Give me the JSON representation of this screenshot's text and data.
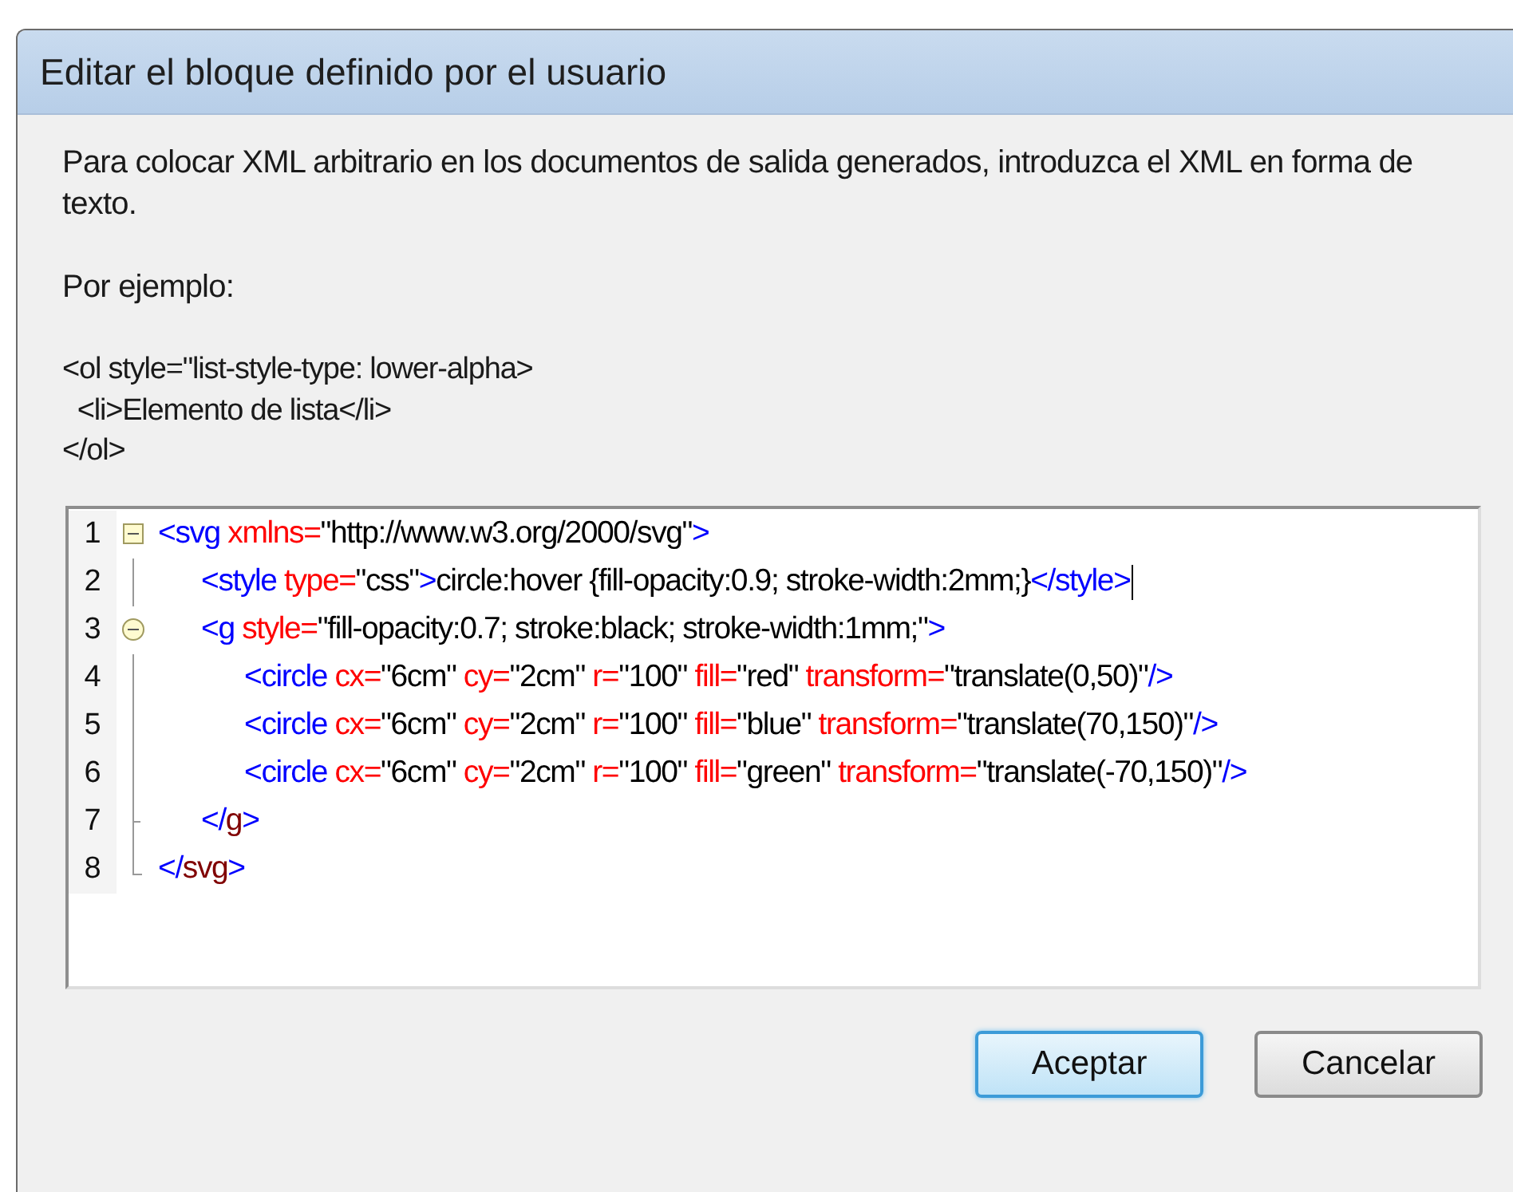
{
  "window": {
    "title": "Editar el bloque definido por el usuario"
  },
  "description": [
    "Para colocar XML arbitrario en los documentos de salida generados, introduzca el XML en forma de texto.",
    "Por ejemplo:"
  ],
  "example": [
    "<ol style=\"list-style-type: lower-alpha>",
    "  <li>Elemento de lista</li>",
    "</ol>"
  ],
  "editor": {
    "lines": [
      {
        "number": "1",
        "kind": "box",
        "cursor": false,
        "tokens": [
          {
            "kind": "punct",
            "text": "<"
          },
          {
            "kind": "tag",
            "text": "svg"
          },
          {
            "kind": "attr",
            "text": " xmlns="
          },
          {
            "kind": "value",
            "text": "\"http://www.w3.org/2000/svg\""
          },
          {
            "kind": "punct",
            "text": ">"
          }
        ],
        "children": [
          {
            "number": "2",
            "kind": "line",
            "cursor": true,
            "tokens": [
              {
                "kind": "punct",
                "text": "<"
              },
              {
                "kind": "tag",
                "text": "style"
              },
              {
                "kind": "attr",
                "text": " type="
              },
              {
                "kind": "value",
                "text": "\"css\""
              },
              {
                "kind": "punct",
                "text": ">"
              },
              {
                "kind": "value",
                "text": "circle:hover {fill-opacity:0.9; stroke-width:2mm;}"
              },
              {
                "kind": "punct",
                "text": "</"
              },
              {
                "kind": "tag",
                "text": "style"
              },
              {
                "kind": "punct",
                "text": ">"
              }
            ]
          },
          {
            "number": "3",
            "kind": "circle",
            "cursor": false,
            "tokens": [
              {
                "kind": "punct",
                "text": "<"
              },
              {
                "kind": "tag",
                "text": "g"
              },
              {
                "kind": "attr",
                "text": " style="
              },
              {
                "kind": "value",
                "text": "\"fill-opacity:0.7; stroke:black; stroke-width:1mm;\""
              },
              {
                "kind": "punct",
                "text": ">"
              }
            ],
            "children": [
              {
                "number": "4",
                "kind": "line",
                "cursor": false,
                "tokens": [
                  {
                    "kind": "punct",
                    "text": "<"
                  },
                  {
                    "kind": "tag",
                    "text": "circle"
                  },
                  {
                    "kind": "attr",
                    "text": " cx="
                  },
                  {
                    "kind": "value",
                    "text": "\"6cm\""
                  },
                  {
                    "kind": "attr",
                    "text": " cy="
                  },
                  {
                    "kind": "value",
                    "text": "\"2cm\""
                  },
                  {
                    "kind": "attr",
                    "text": " r="
                  },
                  {
                    "kind": "value",
                    "text": "\"100\""
                  },
                  {
                    "kind": "attr",
                    "text": " fill="
                  },
                  {
                    "kind": "value",
                    "text": "\"red\""
                  },
                  {
                    "kind": "attr",
                    "text": " transform="
                  },
                  {
                    "kind": "value",
                    "text": "\"translate(0,50)\""
                  },
                  {
                    "kind": "punct",
                    "text": "/>"
                  }
                ]
              },
              {
                "number": "5",
                "kind": "line",
                "cursor": false,
                "tokens": [
                  {
                    "kind": "punct",
                    "text": "<"
                  },
                  {
                    "kind": "tag",
                    "text": "circle"
                  },
                  {
                    "kind": "attr",
                    "text": " cx="
                  },
                  {
                    "kind": "value",
                    "text": "\"6cm\""
                  },
                  {
                    "kind": "attr",
                    "text": " cy="
                  },
                  {
                    "kind": "value",
                    "text": "\"2cm\""
                  },
                  {
                    "kind": "attr",
                    "text": " r="
                  },
                  {
                    "kind": "value",
                    "text": "\"100\""
                  },
                  {
                    "kind": "attr",
                    "text": " fill="
                  },
                  {
                    "kind": "value",
                    "text": "\"blue\""
                  },
                  {
                    "kind": "attr",
                    "text": " transform="
                  },
                  {
                    "kind": "value",
                    "text": "\"translate(70,150)\""
                  },
                  {
                    "kind": "punct",
                    "text": "/>"
                  }
                ]
              },
              {
                "number": "6",
                "kind": "line",
                "cursor": false,
                "tokens": [
                  {
                    "kind": "punct",
                    "text": "<"
                  },
                  {
                    "kind": "tag",
                    "text": "circle"
                  },
                  {
                    "kind": "attr",
                    "text": " cx="
                  },
                  {
                    "kind": "value",
                    "text": "\"6cm\""
                  },
                  {
                    "kind": "attr",
                    "text": " cy="
                  },
                  {
                    "kind": "value",
                    "text": "\"2cm\""
                  },
                  {
                    "kind": "attr",
                    "text": " r="
                  },
                  {
                    "kind": "value",
                    "text": "\"100\""
                  },
                  {
                    "kind": "attr",
                    "text": " fill="
                  },
                  {
                    "kind": "value",
                    "text": "\"green\""
                  },
                  {
                    "kind": "attr",
                    "text": " transform="
                  },
                  {
                    "kind": "value",
                    "text": "\"translate(-70,150)\""
                  },
                  {
                    "kind": "punct",
                    "text": "/>"
                  }
                ]
              }
            ]
          },
          {
            "number": "7",
            "kind": "tick",
            "cursor": false,
            "tokens": [
              {
                "kind": "punct",
                "text": "</"
              },
              {
                "kind": "endtag",
                "text": "g"
              },
              {
                "kind": "punct",
                "text": ">"
              }
            ]
          }
        ]
      },
      {
        "number": "8",
        "kind": "end",
        "cursor": false,
        "tokens": [
          {
            "kind": "punct",
            "text": "</"
          },
          {
            "kind": "endtag",
            "text": "svg"
          },
          {
            "kind": "punct",
            "text": ">"
          }
        ]
      }
    ]
  },
  "buttons": [
    {
      "label": "Aceptar",
      "default": true
    },
    {
      "label": "Cancelar",
      "default": false
    }
  ]
}
